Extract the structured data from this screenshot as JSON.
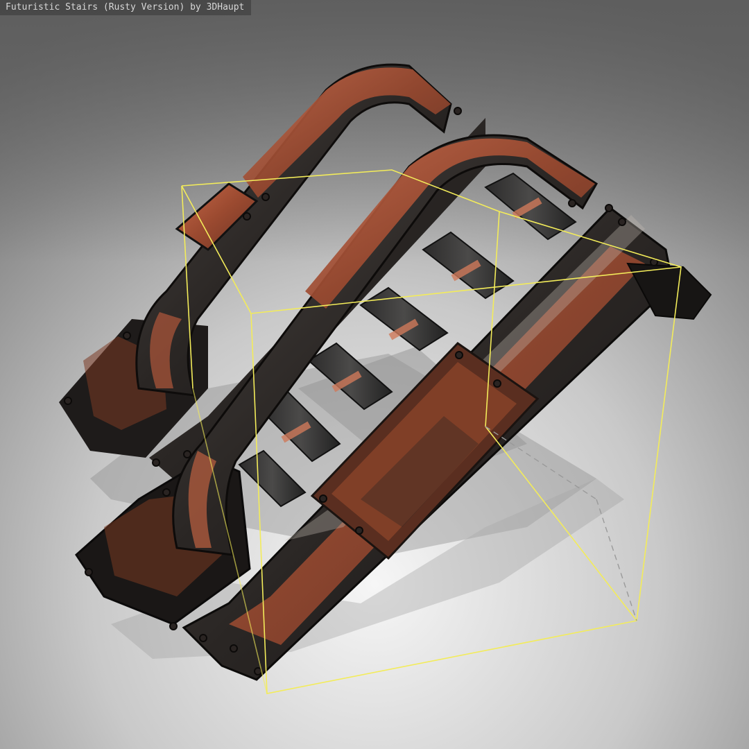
{
  "viewer": {
    "title": "Futuristic Stairs (Rusty Version) by 3DHaupt"
  },
  "scene": {
    "model": "futuristic-stairs-rusty",
    "background_gradient": [
      "#6e6e6e",
      "#b9b9b9",
      "#f6f6f6"
    ],
    "bounding_box_color": "#f3ec5a",
    "rust_color": "#b0573a",
    "metal_color": "#2b2826",
    "icons": [
      "bounding-box",
      "handrail",
      "stair-step",
      "rivet"
    ]
  }
}
